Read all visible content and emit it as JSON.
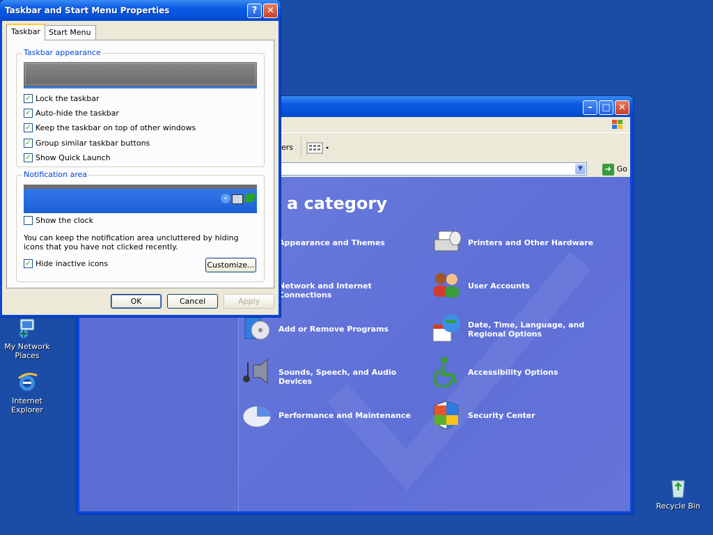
{
  "desktop": {
    "icons": [
      {
        "label": "My Network Places"
      },
      {
        "label": "Internet Explorer"
      },
      {
        "label": "Recycle Bin"
      }
    ]
  },
  "control_panel": {
    "address": {
      "go_label": "Go"
    },
    "toolbar_partial": "ers",
    "heading": "a category",
    "categories": [
      {
        "label": "Appearance and Themes",
        "icon": "appearance-themes-icon"
      },
      {
        "label": "Printers and Other Hardware",
        "icon": "printer-icon"
      },
      {
        "label": "Network and Internet Connections",
        "icon": "network-icon"
      },
      {
        "label": "User Accounts",
        "icon": "user-accounts-icon"
      },
      {
        "label": "Add or Remove Programs",
        "icon": "add-remove-programs-icon"
      },
      {
        "label": "Date, Time, Language, and Regional Options",
        "icon": "date-time-icon"
      },
      {
        "label": "Sounds, Speech, and Audio Devices",
        "icon": "sounds-icon"
      },
      {
        "label": "Accessibility Options",
        "icon": "accessibility-icon"
      },
      {
        "label": "Performance and Maintenance",
        "icon": "performance-icon"
      },
      {
        "label": "Security Center",
        "icon": "security-shield-icon"
      }
    ]
  },
  "dialog": {
    "title": "Taskbar and Start Menu Properties",
    "tabs": [
      {
        "label": "Taskbar"
      },
      {
        "label": "Start Menu"
      }
    ],
    "appearance_group": {
      "legend": "Taskbar appearance",
      "options": [
        {
          "label": "Lock the taskbar",
          "checked": true
        },
        {
          "label": "Auto-hide the taskbar",
          "checked": true
        },
        {
          "label": "Keep the taskbar on top of other windows",
          "checked": true
        },
        {
          "label": "Group similar taskbar buttons",
          "checked": true
        },
        {
          "label": "Show Quick Launch",
          "checked": true
        }
      ]
    },
    "notification_group": {
      "legend": "Notification area",
      "show_clock": {
        "label": "Show the clock",
        "checked": false
      },
      "description": "You can keep the notification area uncluttered by hiding icons that you have not clicked recently.",
      "hide_inactive": {
        "label": "Hide inactive icons",
        "checked": true
      },
      "customize_label": "Customize..."
    },
    "buttons": {
      "ok": "OK",
      "cancel": "Cancel",
      "apply": "Apply"
    },
    "help_label": "?"
  },
  "colors": {
    "titlebar": "#0a5ae3",
    "panel": "#ece9d8",
    "cp_background": "#6f80df"
  }
}
